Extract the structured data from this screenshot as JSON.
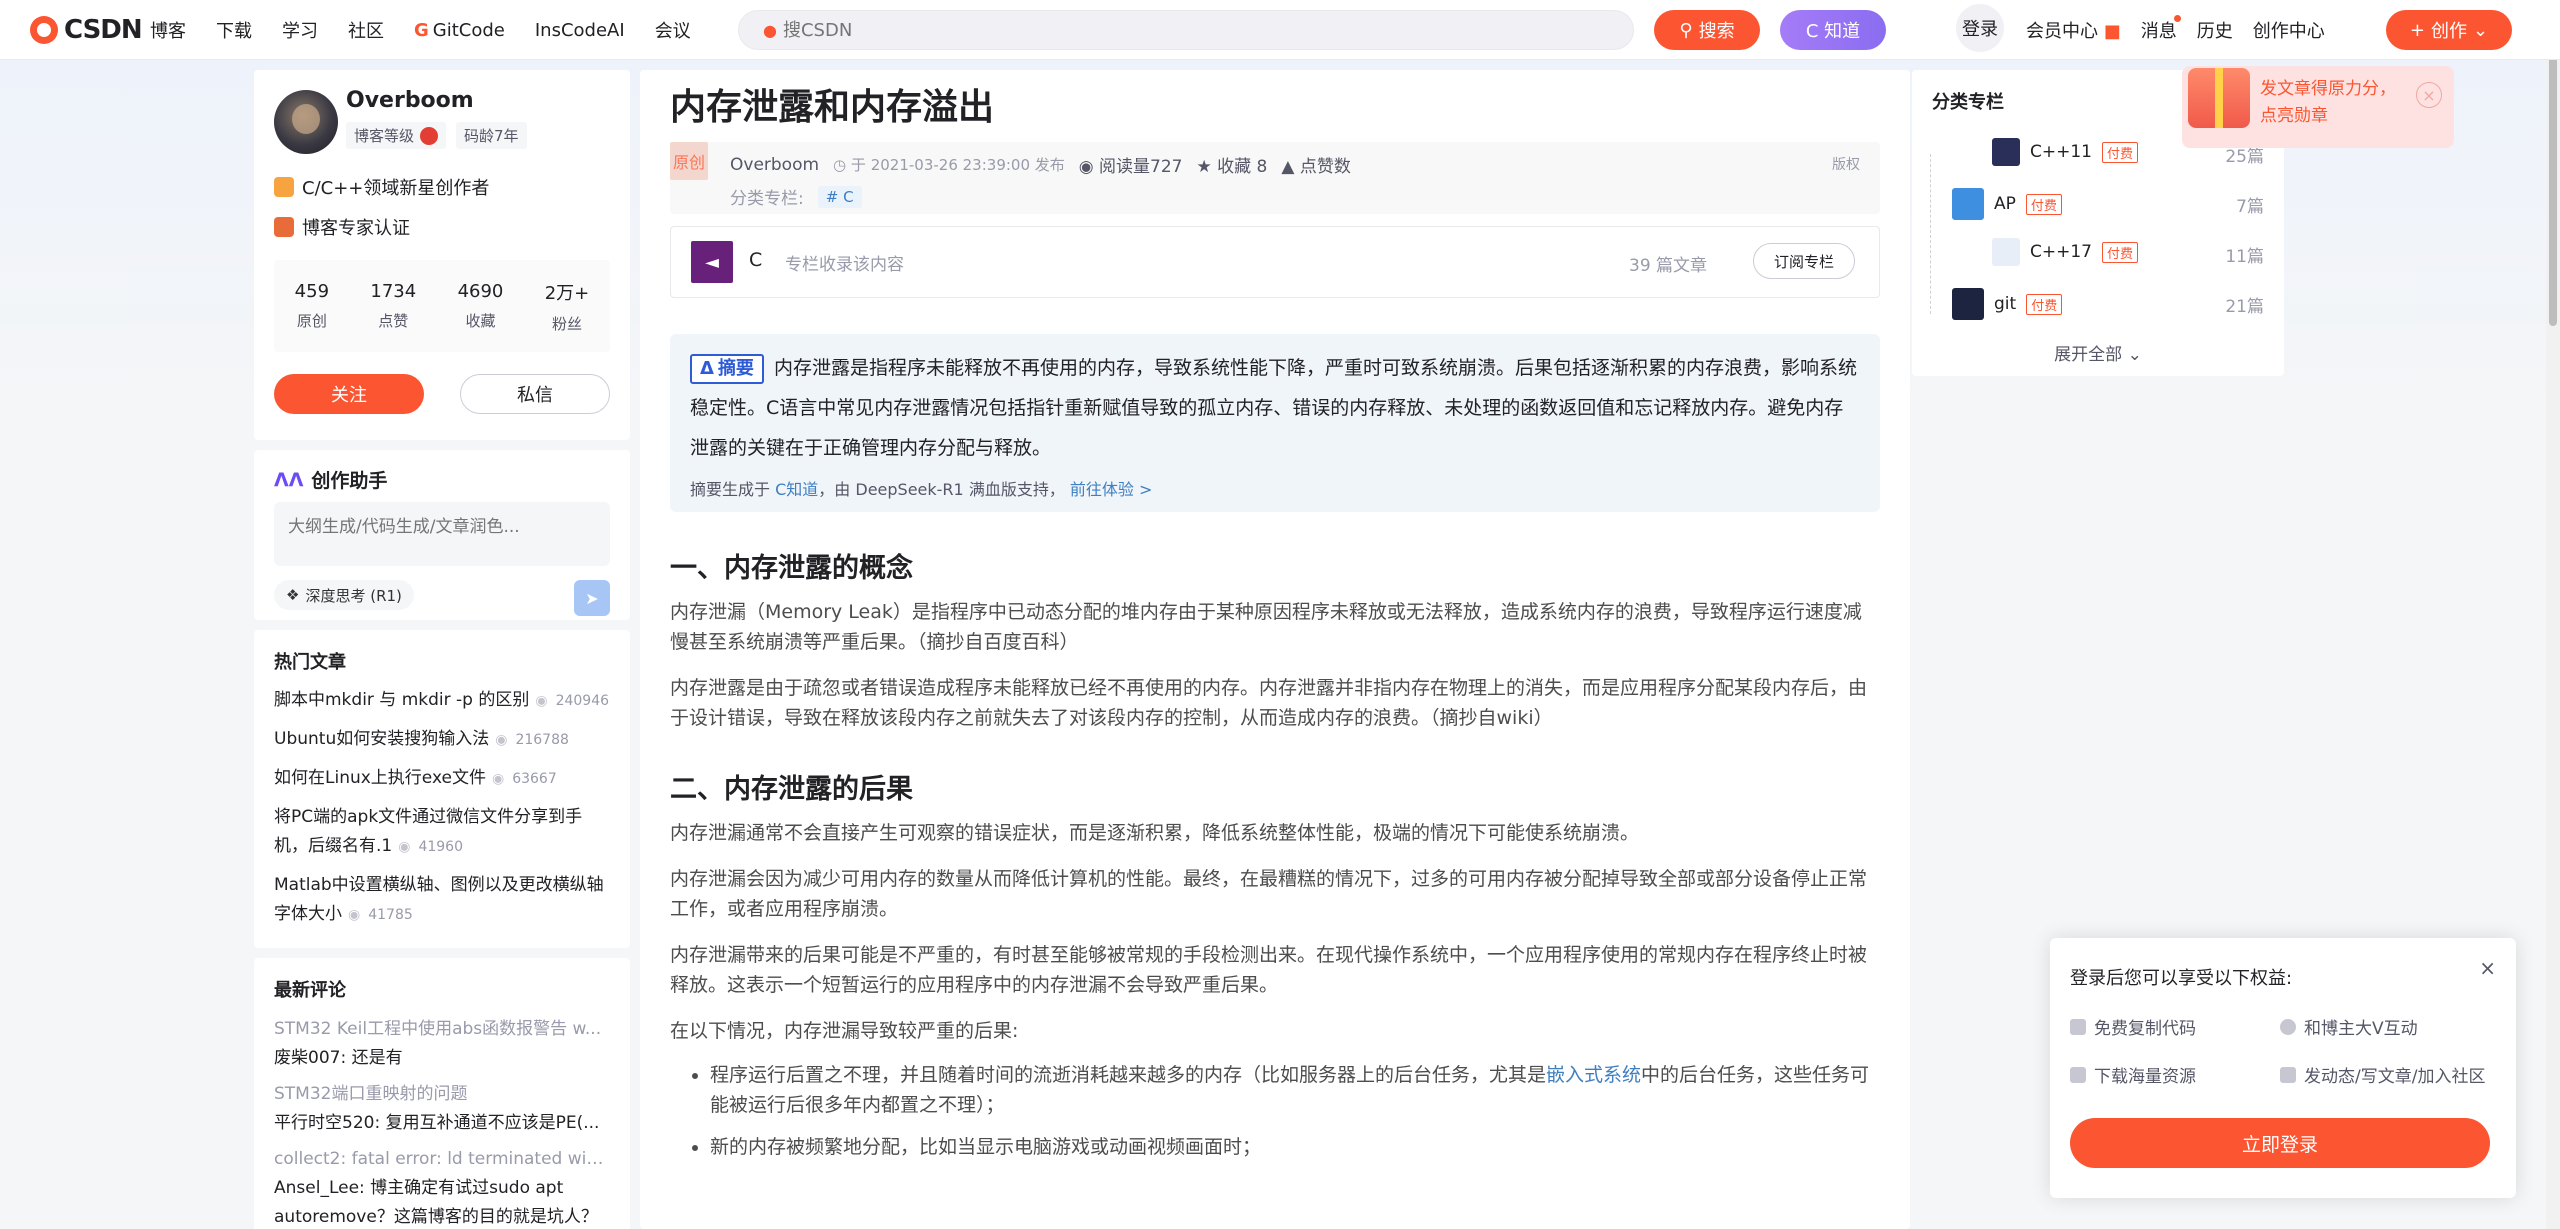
{
  "header": {
    "logo": "CSDN",
    "nav": [
      "博客",
      "下载",
      "学习",
      "社区",
      "GitCode",
      "InsCodeAI",
      "会议"
    ],
    "search_placeholder": "搜CSDN",
    "search_button": "搜索",
    "zhidao_button": "C 知道",
    "login": "登录",
    "vip": "会员中心",
    "messages": "消息",
    "history": "历史",
    "creation": "创作中心",
    "create_button": "创作"
  },
  "profile": {
    "name": "Overboom",
    "level_label": "博客等级",
    "age_label": "码龄7年",
    "title1": "C/C++领域新星创作者",
    "title2": "博客专家认证",
    "stats": [
      {
        "num": "459",
        "label": "原创"
      },
      {
        "num": "1734",
        "label": "点赞"
      },
      {
        "num": "4690",
        "label": "收藏"
      },
      {
        "num": "2万+",
        "label": "粉丝"
      }
    ],
    "follow": "关注",
    "message": "私信"
  },
  "assistant": {
    "title": "创作助手",
    "placeholder": "大纲生成/代码生成/文章润色...",
    "deep": "深度思考 (R1)"
  },
  "hot": {
    "title": "热门文章",
    "items": [
      {
        "title": "脚本中mkdir 与 mkdir -p 的区别",
        "views": "240946"
      },
      {
        "title": "Ubuntu如何安装搜狗输入法",
        "views": "216788"
      },
      {
        "title": "如何在Linux上执行exe文件",
        "views": "63667"
      },
      {
        "title": "将PC端的apk文件通过微信文件分享到手机，后缀名有.1",
        "views": "41960"
      },
      {
        "title": "Matlab中设置横纵轴、图例以及更改横纵轴字体大小",
        "views": "41785"
      }
    ]
  },
  "comments": {
    "title": "最新评论",
    "items": [
      {
        "post": "STM32 Keil工程中使用abs函数报警告 w...",
        "body": "废柴007: 还是有"
      },
      {
        "post": "STM32端口重映射的问题",
        "body": "平行时空520: 复用互补通道不应该是PE(..."
      },
      {
        "post": "collect2: fatal error: ld terminated with si...",
        "body": "Ansel_Lee: 博主确定有试过sudo apt autoremove？这篇博客的目的就是坑人？"
      }
    ]
  },
  "article": {
    "title": "内存泄露和内存溢出",
    "original": "原创",
    "author": "Overboom",
    "published": "于 2021-03-26 23:39:00 发布",
    "reads": "阅读量727",
    "favorites": "收藏 8",
    "likes": "点赞数",
    "copyright": "版权",
    "category_label": "分类专栏:",
    "category_tag": "# C",
    "column_name": "C",
    "column_desc": "专栏收录该内容",
    "column_count": "39 篇文章",
    "subscribe": "订阅专栏",
    "summary_tag": "摘要",
    "summary": "内存泄露是指程序未能释放不再使用的内存，导致系统性能下降，严重时可致系统崩溃。后果包括逐渐积累的内存浪费，影响系统稳定性。C语言中常见内存泄露情况包括指针重新赋值导致的孤立内存、错误的内存释放、未处理的函数返回值和忘记释放内存。避免内存泄露的关键在于正确管理内存分配与释放。",
    "summary_foot_a": "摘要生成于",
    "summary_foot_link": "C知道",
    "summary_foot_b": "，由 DeepSeek-R1 满血版支持，",
    "summary_foot_try": "前往体验 >",
    "h1": "一、内存泄露的概念",
    "p1": "内存泄漏（Memory Leak）是指程序中已动态分配的堆内存由于某种原因程序未释放或无法释放，造成系统内存的浪费，导致程序运行速度减慢甚至系统崩溃等严重后果。（摘抄自百度百科）",
    "p2": "内存泄露是由于疏忽或者错误造成程序未能释放已经不再使用的内存。内存泄露并非指内存在物理上的消失，而是应用程序分配某段内存后，由于设计错误，导致在释放该段内存之前就失去了对该段内存的控制，从而造成内存的浪费。（摘抄自wiki）",
    "h2": "二、内存泄露的后果",
    "p3": "内存泄漏通常不会直接产生可观察的错误症状，而是逐渐积累，降低系统整体性能，极端的情况下可能使系统崩溃。",
    "p4": "内存泄漏会因为减少可用内存的数量从而降低计算机的性能。最终，在最糟糕的情况下，过多的可用内存被分配掉导致全部或部分设备停止正常工作，或者应用程序崩溃。",
    "p5": "内存泄漏带来的后果可能是不严重的，有时甚至能够被常规的手段检测出来。在现代操作系统中，一个应用程序使用的常规内存在程序终止时被释放。这表示一个短暂运行的应用程序中的内存泄漏不会导致严重后果。",
    "p6": "在以下情况，内存泄漏导致较严重的后果:",
    "li1_a": "程序运行后置之不理，并且随着时间的流逝消耗越来越多的内存（比如服务器上的后台任务，尤其是",
    "li1_link": "嵌入式系统",
    "li1_b": "中的后台任务，这些任务可能被运行后很多年内都置之不理）；",
    "li2": "新的内存被频繁地分配，比如当显示电脑游戏或动画视频画面时；"
  },
  "categories": {
    "title": "分类专栏",
    "items": [
      {
        "name": "C++11",
        "paid": "付费",
        "count": "25篇"
      },
      {
        "name": "AP",
        "paid": "付费",
        "count": "7篇"
      },
      {
        "name": "C++17",
        "paid": "付费",
        "count": "11篇"
      },
      {
        "name": "git",
        "paid": "付费",
        "count": "21篇"
      }
    ],
    "expand": "展开全部"
  },
  "promo": {
    "line1": "发文章得原力分，",
    "line2": "点亮勋章"
  },
  "login_popup": {
    "title": "登录后您可以享受以下权益:",
    "b1": "免费复制代码",
    "b2": "和博主大V互动",
    "b3": "下载海量资源",
    "b4": "发动态/写文章/加入社区",
    "button": "立即登录"
  }
}
